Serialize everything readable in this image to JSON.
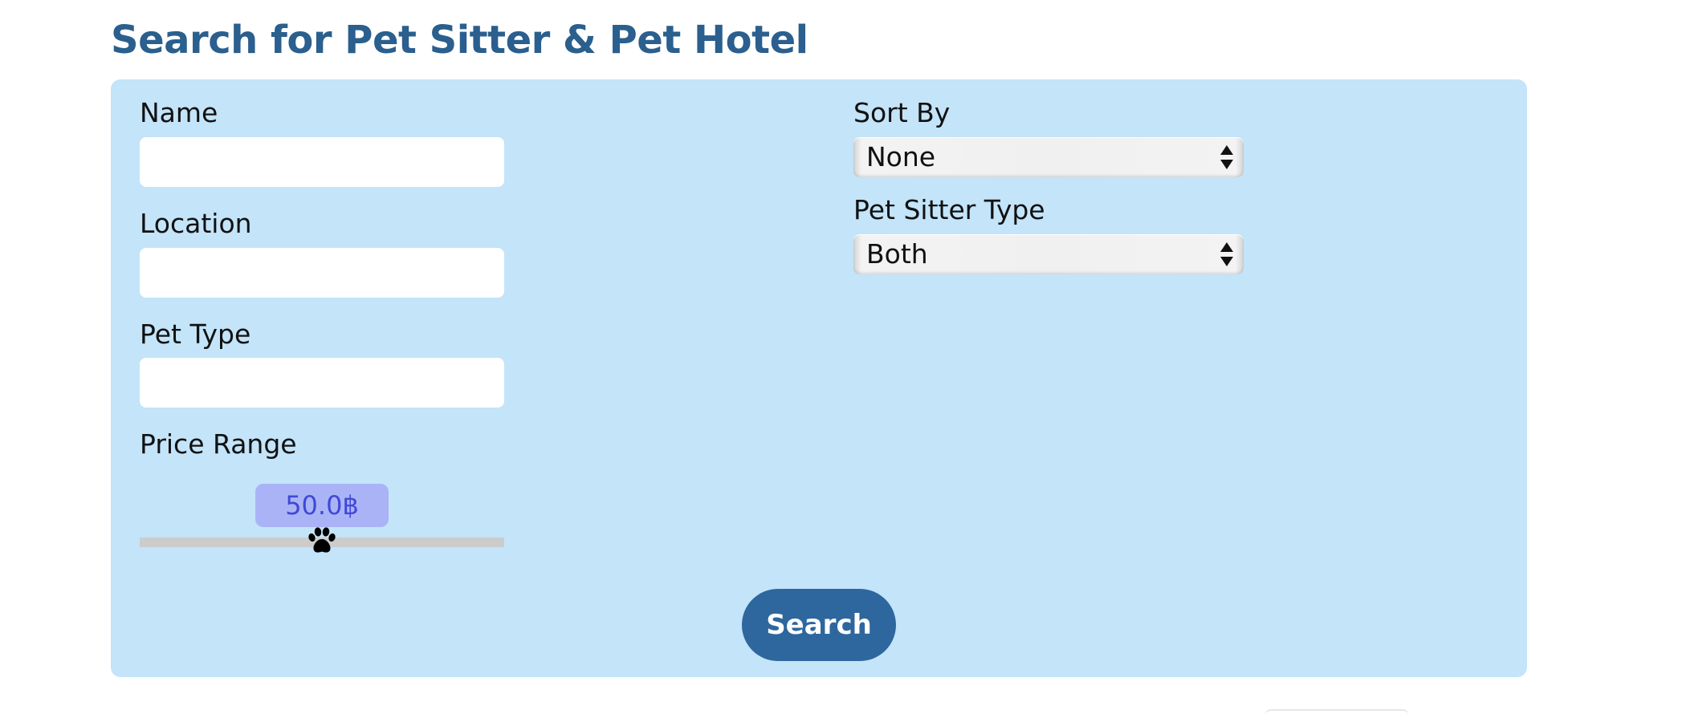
{
  "page": {
    "title": "Search for Pet Sitter & Pet Hotel"
  },
  "form": {
    "name": {
      "label": "Name",
      "value": "",
      "placeholder": ""
    },
    "location": {
      "label": "Location",
      "value": "",
      "placeholder": ""
    },
    "pet_type": {
      "label": "Pet Type",
      "value": "",
      "placeholder": ""
    },
    "price_range": {
      "label": "Price Range",
      "display_value": "50.0฿",
      "value": 50.0,
      "position_fraction": 0.5,
      "thumb_icon": "paw-icon"
    },
    "sort_by": {
      "label": "Sort By",
      "selected": "None"
    },
    "pet_sitter_type": {
      "label": "Pet Sitter Type",
      "selected": "Both"
    },
    "search_label": "Search"
  },
  "colors": {
    "title": "#2a5f8e",
    "panel_background": "#c3e4f9",
    "button": "#2d679e",
    "slider_bubble": "#abb3f7",
    "slider_bubble_text": "#3f49d6",
    "slider_track": "#cccccc"
  }
}
